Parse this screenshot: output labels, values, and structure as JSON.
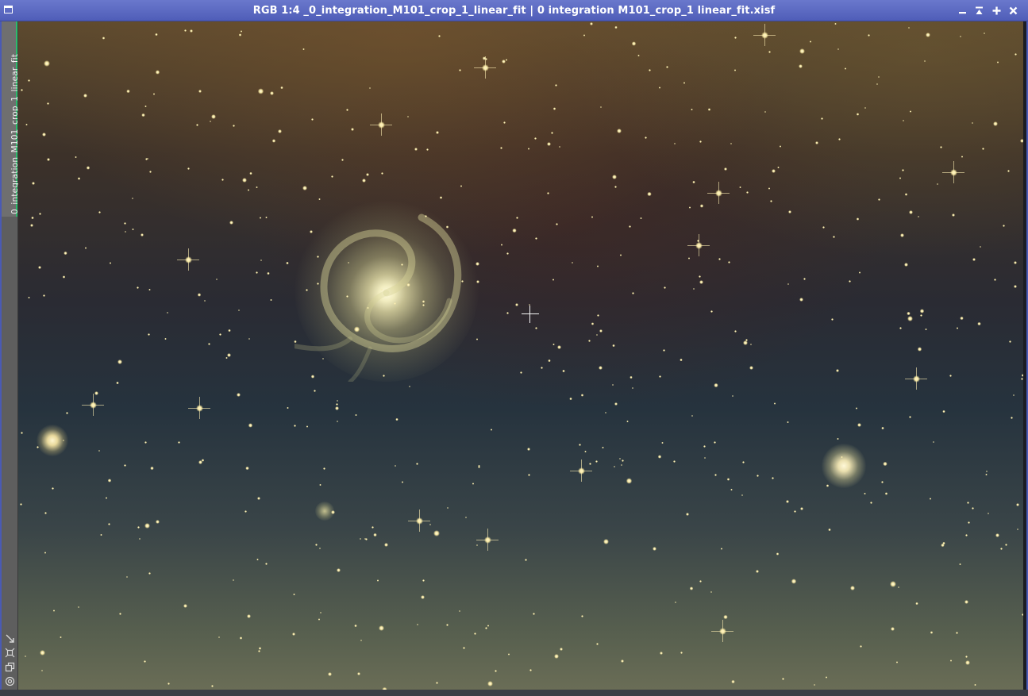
{
  "window": {
    "title": "RGB 1:4 _0_integration_M101_crop_1_linear_fit | 0 integration M101_crop_1 linear_fit.xisf",
    "icons": {
      "app": "image-window-icon",
      "minimize": "minimize-icon",
      "shade": "shade-icon",
      "maximize": "maximize-icon",
      "close": "close-icon"
    },
    "accent_color": "#4f5db8"
  },
  "sidebar": {
    "tab_label": "0_integration_M101_crop_1_linear_fit",
    "tab_indicator_color": "#2dbb6a",
    "tools": [
      {
        "name": "fit-view-icon"
      },
      {
        "name": "zoom-to-fit-icon"
      },
      {
        "name": "clone-view-icon"
      },
      {
        "name": "target-icon"
      }
    ]
  },
  "image": {
    "subject": "M101",
    "zoom": "1:4",
    "color_mode": "RGB"
  }
}
